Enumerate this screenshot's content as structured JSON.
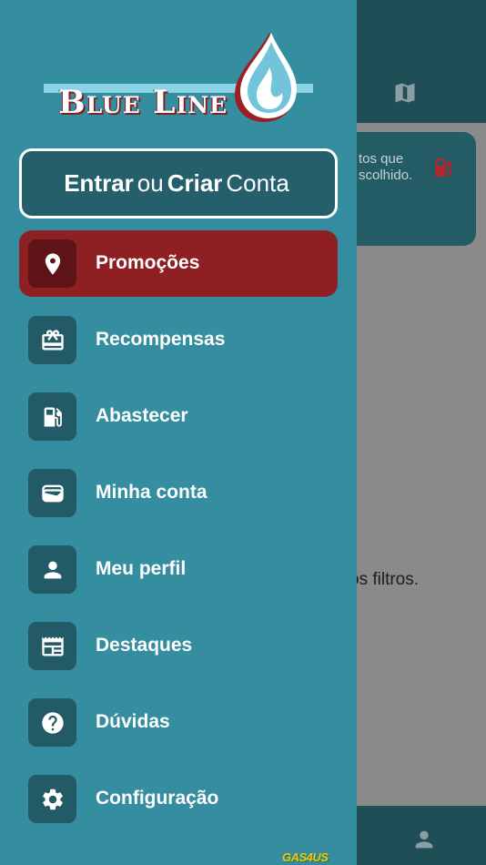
{
  "background": {
    "card_text": "tos que\nscolhido.",
    "filter_text": "os filtros."
  },
  "drawer": {
    "logo_text": "Blue Line",
    "login": {
      "part1": "Entrar",
      "part2": "ou",
      "part3": "Criar",
      "part4": "Conta"
    },
    "menu": [
      {
        "label": "Promoções",
        "icon": "location-pin-icon",
        "active": true
      },
      {
        "label": "Recompensas",
        "icon": "gift-card-icon",
        "active": false
      },
      {
        "label": "Abastecer",
        "icon": "fuel-pump-icon",
        "active": false
      },
      {
        "label": "Minha conta",
        "icon": "wallet-icon",
        "active": false
      },
      {
        "label": "Meu perfil",
        "icon": "person-icon",
        "active": false
      },
      {
        "label": "Destaques",
        "icon": "newspaper-icon",
        "active": false
      },
      {
        "label": "Dúvidas",
        "icon": "help-icon",
        "active": false
      },
      {
        "label": "Configuração",
        "icon": "gear-icon",
        "active": false
      }
    ],
    "powered_by": "GAS4US"
  },
  "colors": {
    "drawer_bg": "#358da0",
    "active_item": "#8e1f23",
    "icon_box": "#225a66",
    "header_bg": "#1f4e57",
    "fuel_red": "#b3262c"
  }
}
